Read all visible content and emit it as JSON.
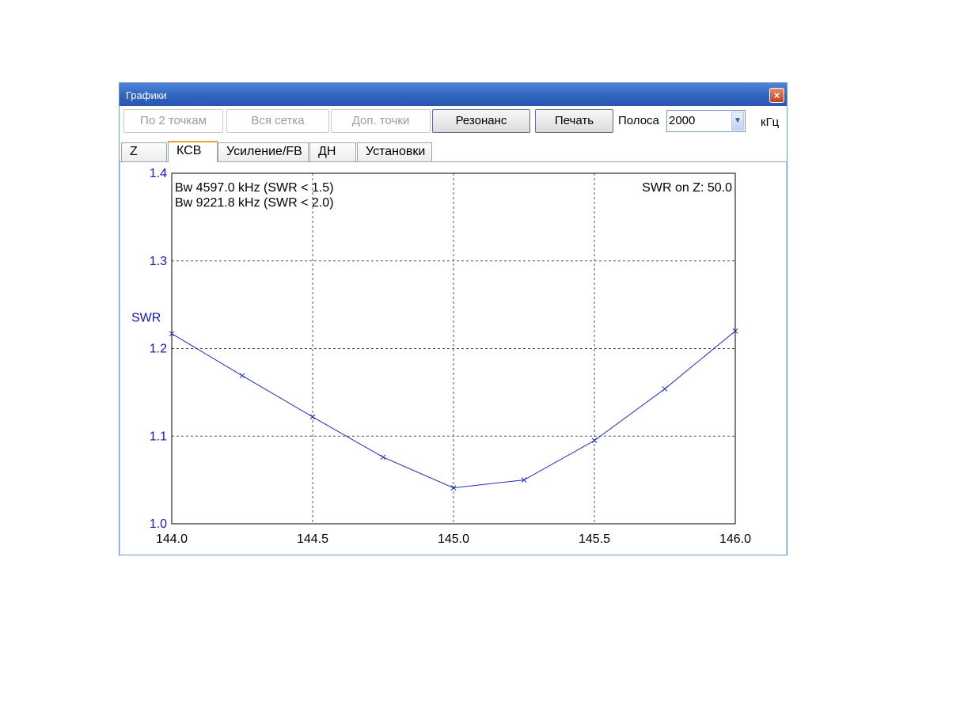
{
  "window": {
    "title": "Графики",
    "close_glyph": "×"
  },
  "toolbar": {
    "btn_two_points": "По 2 точкам",
    "btn_full_grid": "Вся сетка",
    "btn_extra_points": "Доп. точки",
    "btn_resonance": "Резонанс",
    "btn_print": "Печать",
    "band_label": "Полоса",
    "band_value": "2000",
    "band_unit": "кГц"
  },
  "tabs": [
    "Z",
    "КСВ",
    "Усиление/FB",
    "ДН",
    "Установки"
  ],
  "selected_tab": "КСВ",
  "colors": {
    "curve": "#1f2dc0",
    "axis_text": "#1414c8",
    "title_bar": "#2f63bf"
  },
  "chart_data": {
    "type": "line",
    "ylabel": "SWR",
    "xlabel": "",
    "xlim": [
      144.0,
      146.0
    ],
    "ylim": [
      1.0,
      1.4
    ],
    "xticks": [
      "144.0",
      "144.5",
      "145.0",
      "145.5",
      "146.0"
    ],
    "yticks": [
      "1.0",
      "1.1",
      "1.2",
      "1.3",
      "1.4"
    ],
    "grid": true,
    "annotations": {
      "bw15": "Bw 4597.0 kHz (SWR < 1.5)",
      "bw20": "Bw 9221.8 kHz (SWR < 2.0)",
      "swr_on_z": "SWR on Z: 50.0"
    },
    "series": [
      {
        "x": [
          144.0,
          144.25,
          144.5,
          144.75,
          145.0,
          145.25,
          145.5,
          145.75,
          146.0
        ],
        "values": [
          1.217,
          1.169,
          1.122,
          1.076,
          1.041,
          1.05,
          1.095,
          1.154,
          1.22
        ]
      }
    ]
  }
}
